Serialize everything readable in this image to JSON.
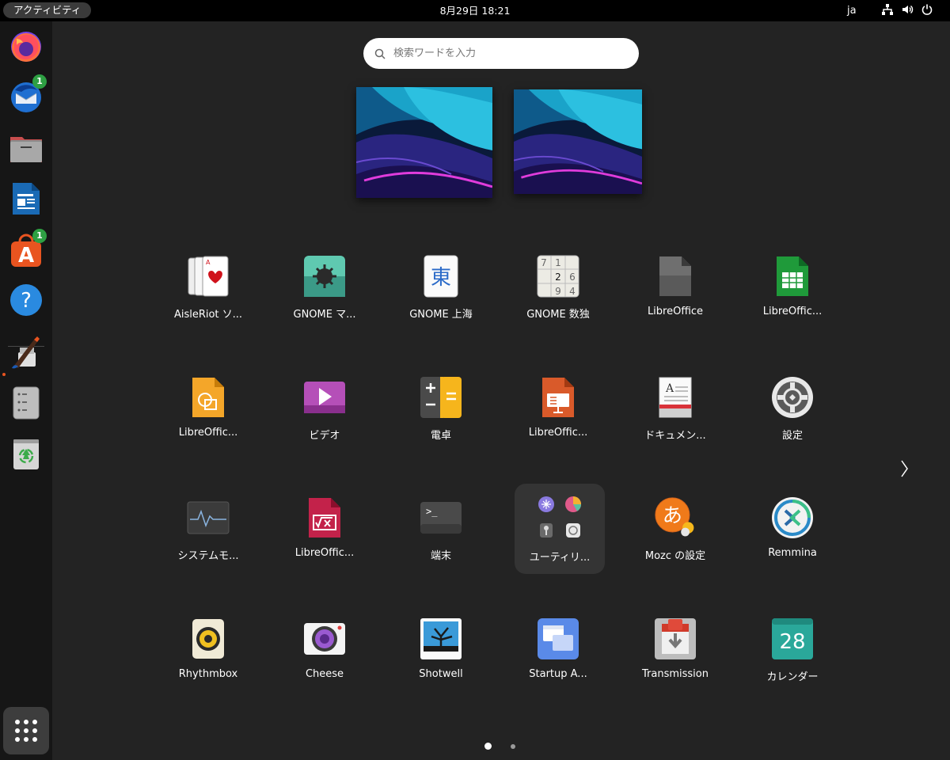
{
  "topbar": {
    "activities": "アクティビティ",
    "datetime": "8月29日  18:21",
    "input_method": "ja"
  },
  "dock": {
    "badges": {
      "thunderbird": "1",
      "software": "1"
    }
  },
  "search": {
    "placeholder": "検索ワードを入力"
  },
  "apps": [
    {
      "label": "AisleRiot ソ..."
    },
    {
      "label": "GNOME マ..."
    },
    {
      "label": "GNOME 上海"
    },
    {
      "label": "GNOME 数独"
    },
    {
      "label": "LibreOffice"
    },
    {
      "label": "LibreOffic..."
    },
    {
      "label": "LibreOffic..."
    },
    {
      "label": "ビデオ"
    },
    {
      "label": "電卓"
    },
    {
      "label": "LibreOffic..."
    },
    {
      "label": "ドキュメン..."
    },
    {
      "label": "設定"
    },
    {
      "label": "システムモ..."
    },
    {
      "label": "LibreOffic..."
    },
    {
      "label": "端末"
    },
    {
      "label": "ユーティリ..."
    },
    {
      "label": "Mozc の設定"
    },
    {
      "label": "Remmina"
    },
    {
      "label": "Rhythmbox"
    },
    {
      "label": "Cheese"
    },
    {
      "label": "Shotwell"
    },
    {
      "label": "Startup A..."
    },
    {
      "label": "Transmission"
    },
    {
      "label": "カレンダー"
    }
  ],
  "icon_text": {
    "mahjongg_char": "東",
    "sudoku_digits": [
      "7",
      "1",
      "2",
      "6",
      "9",
      "4"
    ],
    "calendar_day": "28",
    "mozc_char": "あ",
    "document_letter": "A",
    "terminal_prompt": ">_"
  }
}
